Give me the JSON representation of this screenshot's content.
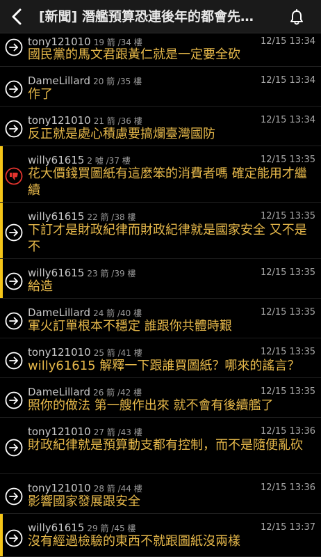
{
  "header": {
    "title": "[新聞] 潛艦預算恐連後年的都會先…"
  },
  "posts": [
    {
      "user": "tony121010",
      "floor": "19 箭 /34 樓",
      "time": "12/15 13:34",
      "text": "國民黨的馬文君跟黃仁就是一定要全砍",
      "type": "reply",
      "hl": false
    },
    {
      "user": "DameLillard",
      "floor": "20 箭 /35 樓",
      "time": "12/15 13:34",
      "text": "作了",
      "type": "reply",
      "hl": false
    },
    {
      "user": "tony121010",
      "floor": "21 箭 /36 樓",
      "time": "12/15 13:34",
      "text": "反正就是處心積慮要搞爛臺灣國防",
      "type": "reply",
      "hl": false
    },
    {
      "user": "willy61615",
      "floor": "2 噓 /37 樓",
      "time": "12/15 13:35",
      "text": "花大價錢買圖紙有這麼笨的消費者嗎 確定能用才繼續",
      "type": "boo",
      "hl": true
    },
    {
      "user": "willy61615",
      "floor": "22 箭 /38 樓",
      "time": "12/15 13:35",
      "text": "下訂才是財政紀律而財政紀律就是國家安全 又不是不",
      "type": "reply",
      "hl": true
    },
    {
      "user": "willy61615",
      "floor": "23 箭 /39 樓",
      "time": "12/15 13:35",
      "text": "給造",
      "type": "reply",
      "hl": true
    },
    {
      "user": "DameLillard",
      "floor": "24 箭 /40 樓",
      "time": "12/15 13:35",
      "text": "軍火訂單根本不穩定 誰跟你共體時艱",
      "type": "reply",
      "hl": false
    },
    {
      "user": "tony121010",
      "floor": "25 箭 /41 樓",
      "time": "12/15 13:35",
      "text": "willy61615 解釋一下跟誰買圖紙？哪來的謠言？",
      "type": "reply",
      "hl": false
    },
    {
      "user": "DameLillard",
      "floor": "26 箭 /42 樓",
      "time": "12/15 13:35",
      "text": "照你的做法 第一艘作出來 就不會有後續艦了",
      "type": "reply",
      "hl": false
    },
    {
      "user": "tony121010",
      "floor": "27 箭 /43 樓",
      "time": "12/15 13:36",
      "text": "財政紀律就是預算動支都有控制，而不是隨便亂砍",
      "type": "reply",
      "hl": false
    },
    {
      "user": "tony121010",
      "floor": "28 箭 /44 樓",
      "time": "12/15 13:36",
      "text": "影響國家發展跟安全",
      "type": "reply",
      "hl": false
    },
    {
      "user": "willy61615",
      "floor": "29 箭 /45 樓",
      "time": "12/15 13:37",
      "text": "沒有經過檢驗的東西不就跟圖紙沒兩樣",
      "type": "reply",
      "hl": true
    }
  ]
}
